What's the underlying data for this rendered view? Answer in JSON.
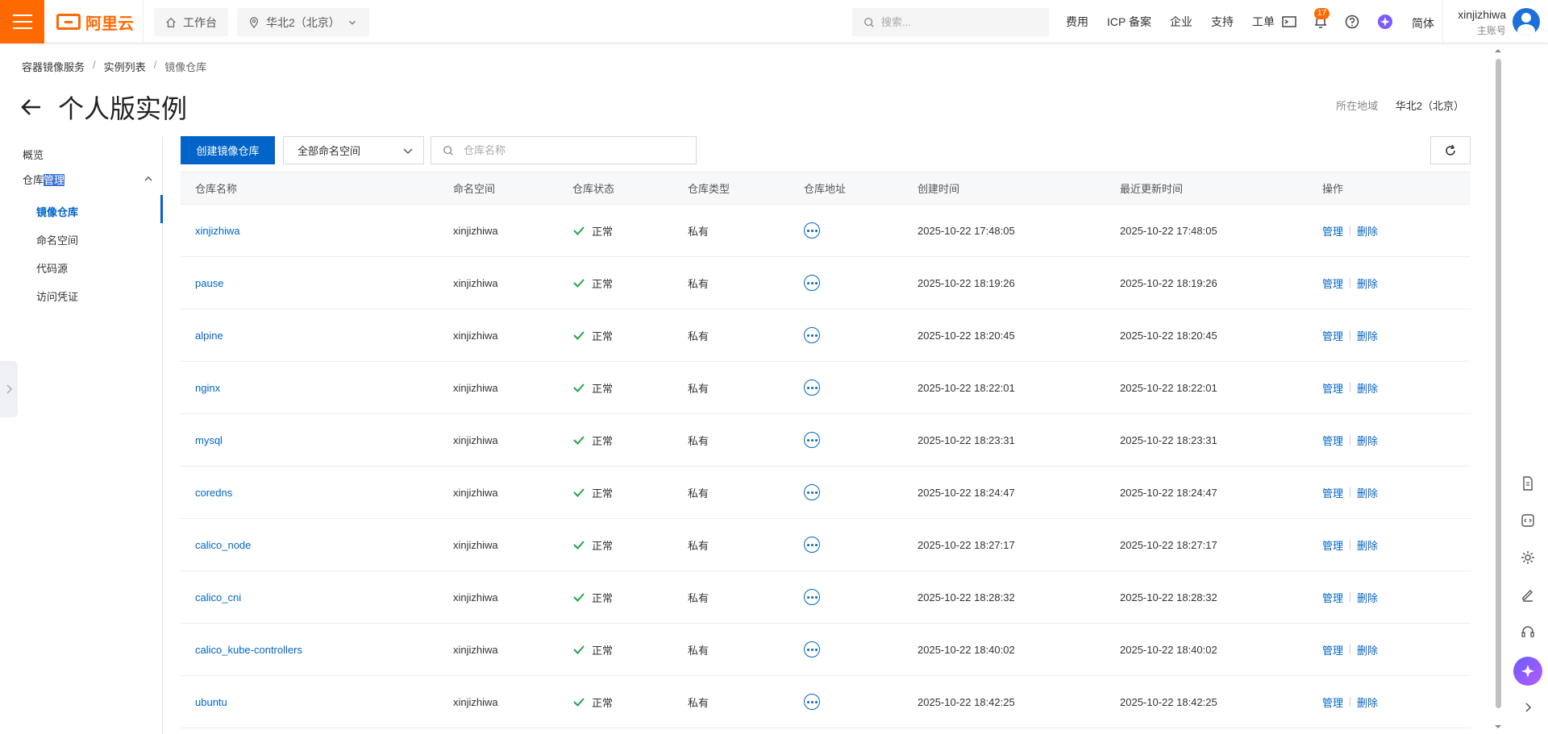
{
  "header": {
    "brand": "阿里云",
    "workbench": "工作台",
    "region_selector": "华北2（北京）",
    "search_placeholder": "搜索...",
    "nav": [
      "费用",
      "ICP 备案",
      "企业",
      "支持",
      "工单"
    ],
    "notification_count": "17",
    "language": "简体",
    "user_name": "xinjizhiwa",
    "user_role": "主账号"
  },
  "breadcrumb": [
    "容器镜像服务",
    "实例列表",
    "镜像仓库"
  ],
  "page_title": "个人版实例",
  "region_label": "所在地域",
  "region_value": "华北2（北京）",
  "sidebar": {
    "overview": "概览",
    "group_prefix": "仓库",
    "group_highlight": "管理",
    "items": [
      "镜像仓库",
      "命名空间",
      "代码源",
      "访问凭证"
    ],
    "active_index": 0
  },
  "toolbar": {
    "create_label": "创建镜像仓库",
    "namespace_select": "全部命名空间",
    "filter_placeholder": "仓库名称"
  },
  "table": {
    "columns": [
      "仓库名称",
      "命名空间",
      "仓库状态",
      "仓库类型",
      "仓库地址",
      "创建时间",
      "最近更新时间",
      "操作"
    ],
    "rows": [
      {
        "name": "xinjizhiwa",
        "namespace": "xinjizhiwa",
        "status": "正常",
        "type": "私有",
        "created": "2025-10-22 17:48:05",
        "updated": "2025-10-22 17:48:05",
        "op1": "管理",
        "op2": "删除"
      },
      {
        "name": "pause",
        "namespace": "xinjizhiwa",
        "status": "正常",
        "type": "私有",
        "created": "2025-10-22 18:19:26",
        "updated": "2025-10-22 18:19:26",
        "op1": "管理",
        "op2": "删除"
      },
      {
        "name": "alpine",
        "namespace": "xinjizhiwa",
        "status": "正常",
        "type": "私有",
        "created": "2025-10-22 18:20:45",
        "updated": "2025-10-22 18:20:45",
        "op1": "管理",
        "op2": "删除"
      },
      {
        "name": "nginx",
        "namespace": "xinjizhiwa",
        "status": "正常",
        "type": "私有",
        "created": "2025-10-22 18:22:01",
        "updated": "2025-10-22 18:22:01",
        "op1": "管理",
        "op2": "删除"
      },
      {
        "name": "mysql",
        "namespace": "xinjizhiwa",
        "status": "正常",
        "type": "私有",
        "created": "2025-10-22 18:23:31",
        "updated": "2025-10-22 18:23:31",
        "op1": "管理",
        "op2": "删除"
      },
      {
        "name": "coredns",
        "namespace": "xinjizhiwa",
        "status": "正常",
        "type": "私有",
        "created": "2025-10-22 18:24:47",
        "updated": "2025-10-22 18:24:47",
        "op1": "管理",
        "op2": "删除"
      },
      {
        "name": "calico_node",
        "namespace": "xinjizhiwa",
        "status": "正常",
        "type": "私有",
        "created": "2025-10-22 18:27:17",
        "updated": "2025-10-22 18:27:17",
        "op1": "管理",
        "op2": "删除"
      },
      {
        "name": "calico_cni",
        "namespace": "xinjizhiwa",
        "status": "正常",
        "type": "私有",
        "created": "2025-10-22 18:28:32",
        "updated": "2025-10-22 18:28:32",
        "op1": "管理",
        "op2": "删除"
      },
      {
        "name": "calico_kube-controllers",
        "namespace": "xinjizhiwa",
        "status": "正常",
        "type": "私有",
        "created": "2025-10-22 18:40:02",
        "updated": "2025-10-22 18:40:02",
        "op1": "管理",
        "op2": "删除"
      },
      {
        "name": "ubuntu",
        "namespace": "xinjizhiwa",
        "status": "正常",
        "type": "私有",
        "created": "2025-10-22 18:42:25",
        "updated": "2025-10-22 18:42:25",
        "op1": "管理",
        "op2": "删除"
      }
    ]
  },
  "colors": {
    "brand": "#ff6a00",
    "primary": "#0064c8",
    "success": "#23a34d"
  }
}
